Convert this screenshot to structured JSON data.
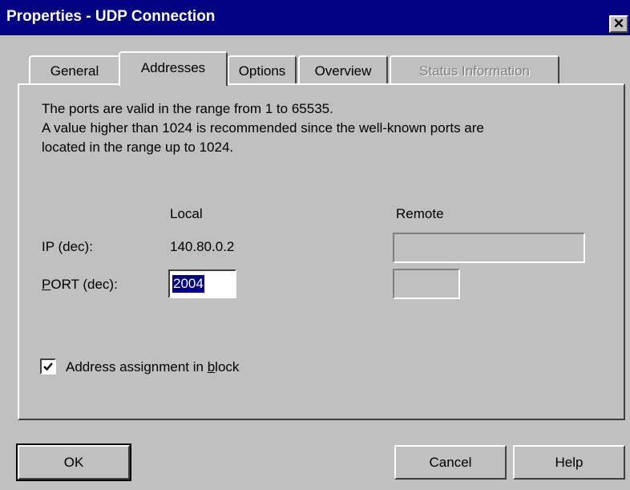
{
  "window": {
    "title": "Properties - UDP Connection",
    "close_glyph": "✕"
  },
  "tabs": [
    {
      "label": "General",
      "state": "inactive"
    },
    {
      "label": "Addresses",
      "state": "active"
    },
    {
      "label": "Options",
      "state": "inactive"
    },
    {
      "label": "Overview",
      "state": "inactive"
    },
    {
      "label": "Status Information",
      "state": "disabled"
    }
  ],
  "description": {
    "line1": "The ports are valid in the range from 1 to 65535.",
    "line2": "A value higher than 1024 is recommended since the well-known ports are",
    "line3": "located in the range up to 1024."
  },
  "columns": {
    "local": "Local",
    "remote": "Remote"
  },
  "ip": {
    "label": "IP (dec):",
    "local_value": "140.80.0.2",
    "remote_value": ""
  },
  "port": {
    "label_mnemonic": "P",
    "label_rest": "ORT (dec):",
    "local_value": "2004",
    "remote_value": ""
  },
  "address_assignment": {
    "label_before": "Address assignment in ",
    "label_mnemonic": "b",
    "label_after": "lock",
    "checked": true
  },
  "buttons": {
    "ok": "OK",
    "cancel": "Cancel",
    "help": "Help"
  },
  "colors": {
    "titlebar": "#000080",
    "dialog_bg": "#c0c0c0",
    "selection": "#000080"
  }
}
